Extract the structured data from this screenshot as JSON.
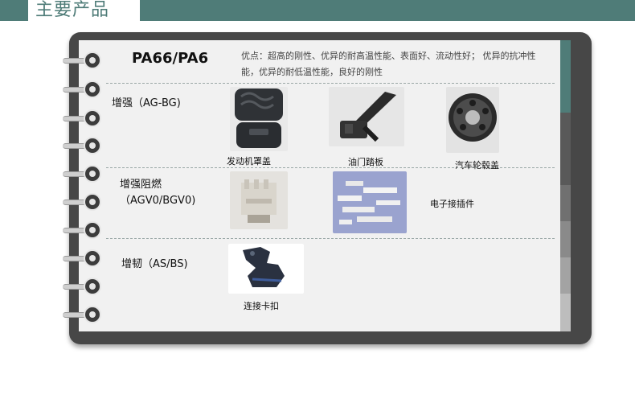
{
  "header": {
    "title": "主要产品",
    "color": "#4f7c78"
  },
  "notebook": {
    "frame_color": "#474747",
    "paper_color": "#f1f1f1",
    "tab_colors": [
      "#4f7c78",
      "#4f7c78",
      "#595959",
      "#595959",
      "#707070",
      "#8a8a8a",
      "#a3a3a3",
      "#bdbdbd"
    ]
  },
  "material": {
    "name": "PA66/PA6",
    "advantage": "优点：超高的刚性、优异的耐高温性能、表面好、流动性好；   优异的抗冲性能，优异的耐低温性能，良好的刚性"
  },
  "categories": [
    {
      "label": "增强（AG-BG)",
      "items": [
        {
          "caption": "发动机罩盖",
          "icon": "engine-cover-photo"
        },
        {
          "caption": "油门踏板",
          "icon": "throttle-pedal-photo"
        },
        {
          "caption": "汽车轮毂盖",
          "icon": "wheel-hub-cover-photo"
        }
      ]
    },
    {
      "label_line1": "增强阻燃",
      "label_line2": "（AGV0/BGV0)",
      "items": [
        {
          "caption": "",
          "icon": "flame-retardant-part-photo"
        },
        {
          "caption": "电子接插件",
          "icon": "electronic-connector-photo"
        }
      ]
    },
    {
      "label": "增韧（AS/BS)",
      "items": [
        {
          "caption": "连接卡扣",
          "icon": "connector-clip-photo"
        }
      ]
    }
  ]
}
